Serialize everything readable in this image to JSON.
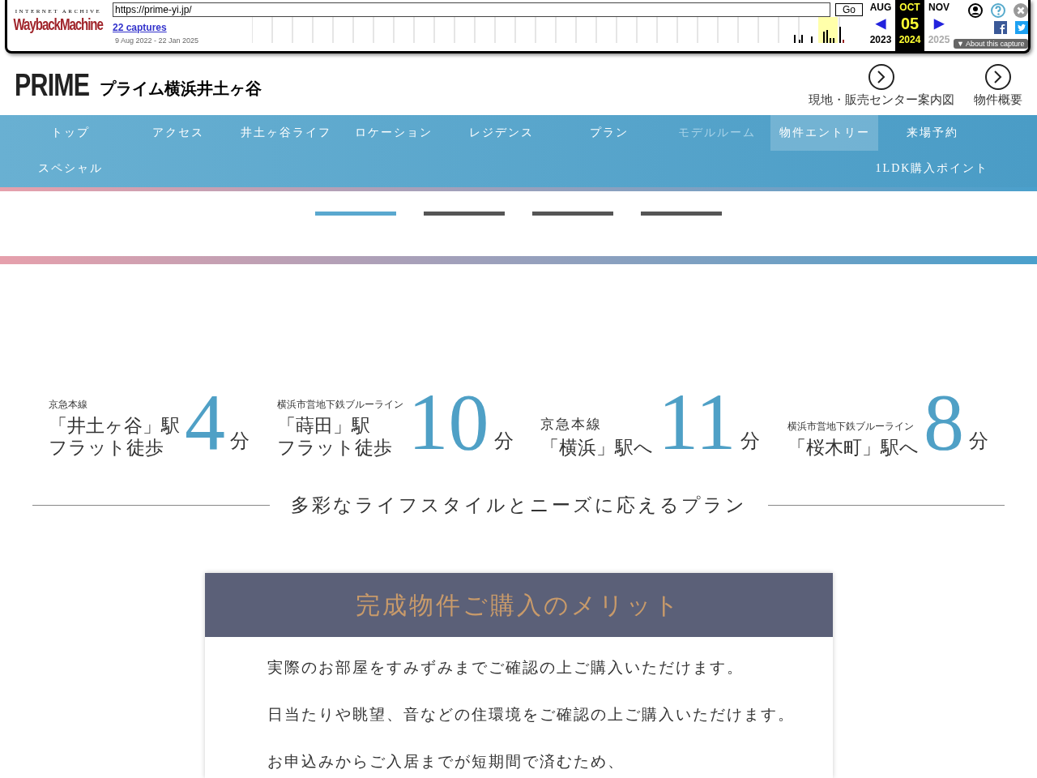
{
  "wayback": {
    "archive_label": "INTERNET ARCHIVE",
    "logo": "WaybackMachine",
    "url": "https://prime-yi.jp/",
    "go": "Go",
    "captures": "22 captures",
    "range": "9 Aug 2022 - 22 Jan 2025",
    "months": [
      {
        "month": "AUG",
        "year": "2023",
        "selected": false
      },
      {
        "month": "OCT",
        "day": "05",
        "year": "2024",
        "selected": true
      },
      {
        "month": "NOV",
        "year": "2025",
        "selected": false
      }
    ],
    "prev": "◀",
    "next": "▶",
    "about_icon": "▼",
    "about": "About this capture"
  },
  "header": {
    "logo": "PRIME",
    "title": "プライム横浜井土ヶ谷",
    "links": [
      "現地・販売センター案内図",
      "物件概要"
    ]
  },
  "nav": {
    "rows": [
      [
        {
          "label": "トップ",
          "selected": false,
          "disabled": false
        },
        {
          "label": "アクセス",
          "selected": false,
          "disabled": false
        },
        {
          "label": "井土ヶ谷ライフ",
          "selected": false,
          "disabled": false
        },
        {
          "label": "ロケーション",
          "selected": false,
          "disabled": false
        },
        {
          "label": "レジデンス",
          "selected": false,
          "disabled": false
        },
        {
          "label": "プラン",
          "selected": false,
          "disabled": false
        },
        {
          "label": "モデルルーム",
          "selected": false,
          "disabled": true
        },
        {
          "label": "物件エントリー",
          "selected": true,
          "disabled": false
        },
        {
          "label": "来場予約",
          "selected": false,
          "disabled": false
        }
      ],
      [
        {
          "label": "スペシャル",
          "selected": false,
          "disabled": false
        },
        "",
        "",
        "",
        "",
        "",
        "",
        "",
        {
          "label": "1LDK購入ポイント",
          "selected": false,
          "disabled": false
        }
      ]
    ]
  },
  "slider_dots": [
    {
      "selected": true
    },
    {
      "selected": false
    },
    {
      "selected": false
    },
    {
      "selected": false
    }
  ],
  "access": [
    {
      "line": "京急本線",
      "station": "「井土ヶ谷」駅",
      "sub": "フラット徒歩",
      "minutes": "4",
      "unit": "分"
    },
    {
      "line": "横浜市営地下鉄ブルーライン",
      "station": "「蒔田」駅",
      "sub": "フラット徒歩",
      "minutes": "10",
      "unit": "分"
    },
    {
      "line": "京急本線",
      "station": "「横浜」駅へ",
      "minutes": "11",
      "unit": "分"
    },
    {
      "line": "横浜市営地下鉄ブルーライン",
      "station": "「桜木町」駅へ",
      "minutes": "8",
      "unit": "分"
    }
  ],
  "plan_heading": "多彩なライフスタイルとニーズに応えるプラン",
  "merit": {
    "title": "完成物件ご購入のメリット",
    "points": [
      "実際のお部屋をすみずみまでご確認の上ご購入いただけます。",
      "日当たりや眺望、音などの住環境をご確認の上ご購入いただけます。",
      "お申込みからご入居までが短期間で済むため、"
    ]
  }
}
